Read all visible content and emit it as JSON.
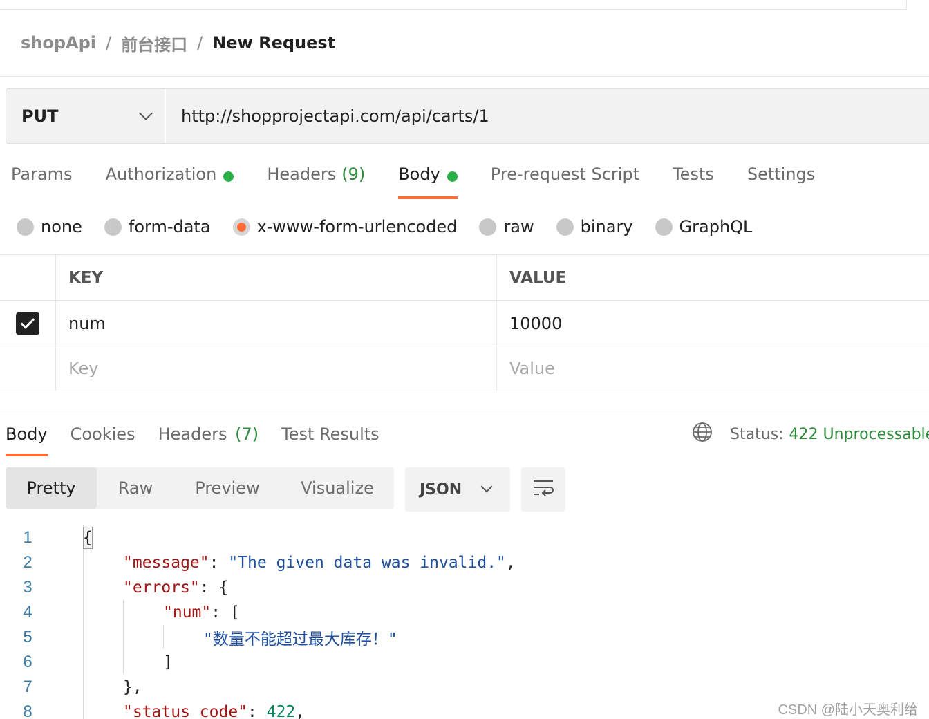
{
  "breadcrumb": {
    "items": [
      "shopApi",
      "前台接口",
      "New Request"
    ],
    "separator": "/"
  },
  "request": {
    "method": "PUT",
    "url": "http://shopprojectapi.com/api/carts/1"
  },
  "request_tabs": [
    {
      "label": "Params"
    },
    {
      "label": "Authorization",
      "indicator": "green-dot"
    },
    {
      "label": "Headers",
      "count": "(9)"
    },
    {
      "label": "Body",
      "indicator": "green-dot",
      "active": true
    },
    {
      "label": "Pre-request Script"
    },
    {
      "label": "Tests"
    },
    {
      "label": "Settings"
    }
  ],
  "body_types": {
    "options": [
      "none",
      "form-data",
      "x-www-form-urlencoded",
      "raw",
      "binary",
      "GraphQL"
    ],
    "selected": "x-www-form-urlencoded"
  },
  "kv_table": {
    "headers": [
      "KEY",
      "VALUE"
    ],
    "rows": [
      {
        "enabled": true,
        "key": "num",
        "value": "10000"
      }
    ],
    "placeholder": {
      "key": "Key",
      "value": "Value"
    }
  },
  "response_tabs": [
    {
      "label": "Body",
      "active": true
    },
    {
      "label": "Cookies"
    },
    {
      "label": "Headers",
      "count": "(7)"
    },
    {
      "label": "Test Results"
    }
  ],
  "status": {
    "label": "Status:",
    "value": "422 Unprocessable"
  },
  "view_modes": {
    "options": [
      "Pretty",
      "Raw",
      "Preview",
      "Visualize"
    ],
    "selected": "Pretty"
  },
  "language": "JSON",
  "code_lines": [
    {
      "n": "1",
      "text": "{"
    },
    {
      "n": "2",
      "key": "\"message\"",
      "punct": ": ",
      "str": "\"The given data was invalid.\"",
      "tail": ","
    },
    {
      "n": "3",
      "key": "\"errors\"",
      "punct": ": {"
    },
    {
      "n": "4",
      "key": "\"num\"",
      "punct": ": ["
    },
    {
      "n": "5",
      "str": "\"数量不能超过最大库存！\""
    },
    {
      "n": "6",
      "text": "]"
    },
    {
      "n": "7",
      "text": "},"
    },
    {
      "n": "8",
      "key": "\"status_code\"",
      "punct": ": ",
      "num": "422",
      "tail": ","
    }
  ],
  "watermark": "CSDN @陆小天奥利给",
  "colors": {
    "accent": "#ff6c37",
    "success": "#2bb14a",
    "status_text": "#2d8a3a",
    "json_key": "#a31515",
    "json_string": "#1f4fa0",
    "line_number": "#3b7ea8"
  }
}
